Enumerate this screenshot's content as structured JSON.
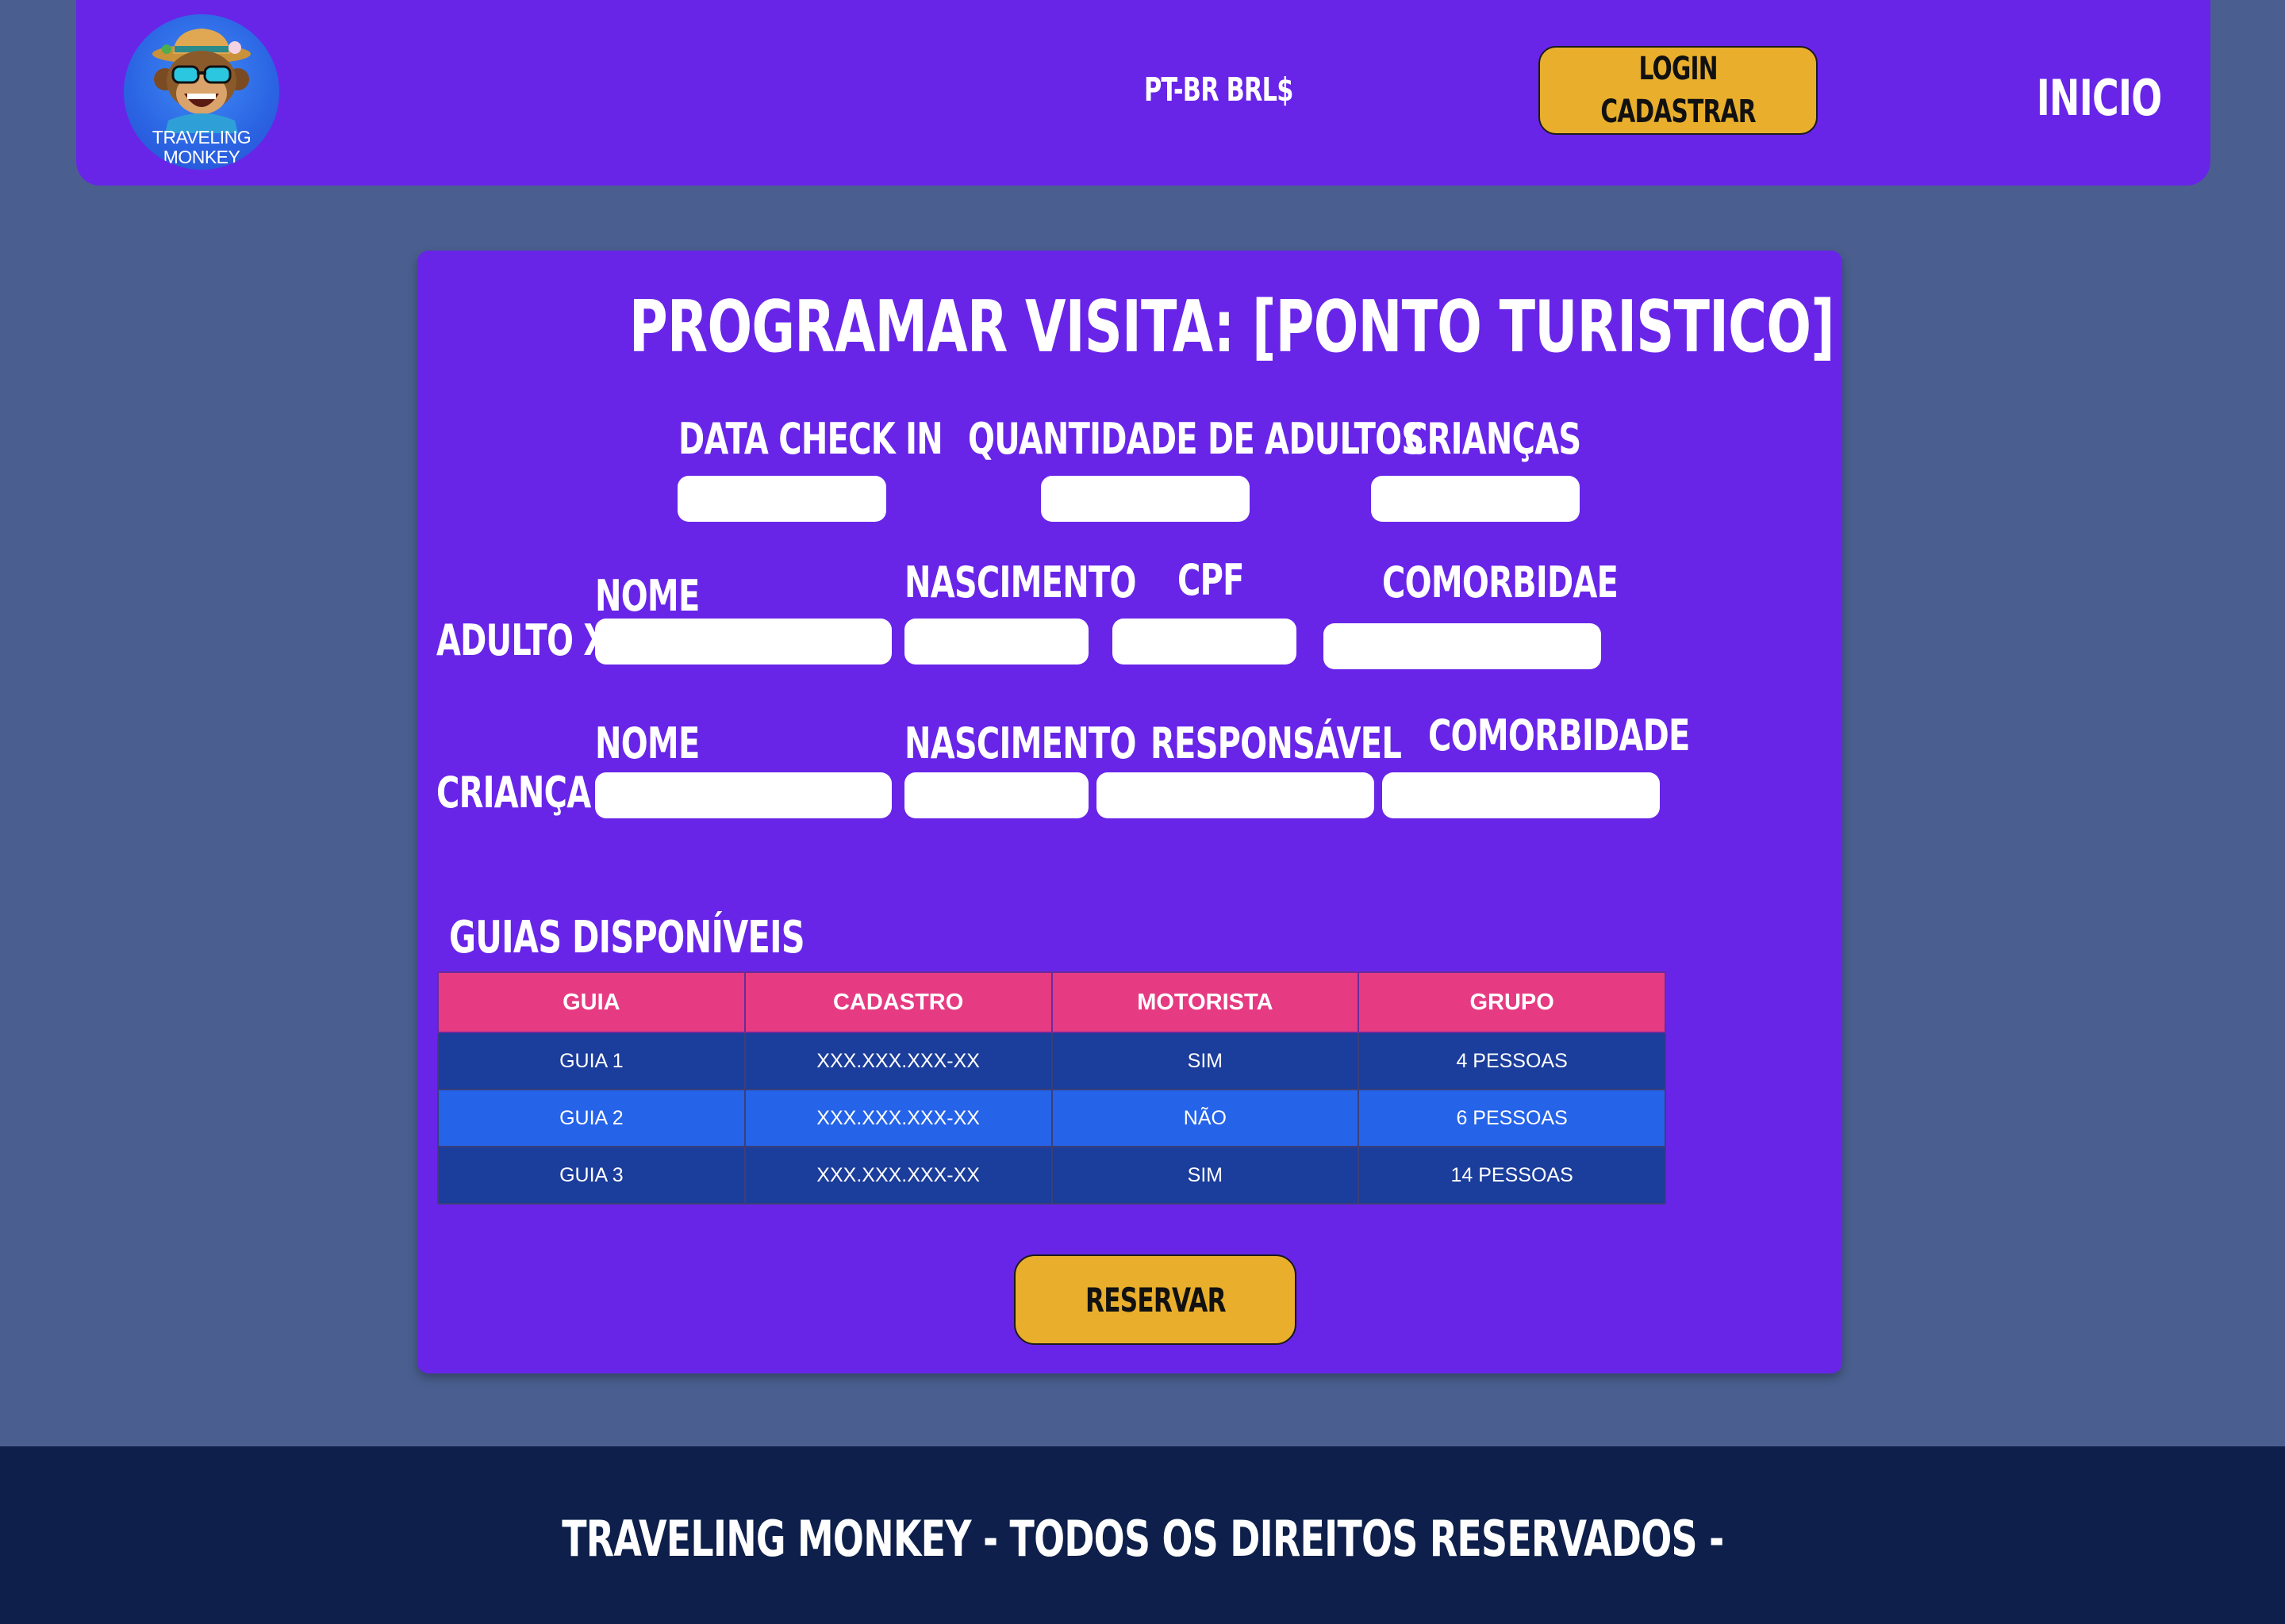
{
  "header": {
    "logo_line1": "TRAVELING",
    "logo_line2": "MONKEY",
    "locale": "PT-BR BRL$",
    "login_line1": "LOGIN",
    "login_line2": "CADASTRAR",
    "nav_home": "INICIO"
  },
  "form": {
    "title": "PROGRAMAR VISITA: [PONTO TURISTICO]",
    "checkin_label": "DATA CHECK IN",
    "adults_qty_label": "QUANTIDADE DE ADULTOS",
    "children_label": "CRIANÇAS",
    "adult": {
      "row_label": "ADULTO X",
      "name_label": "NOME",
      "birth_label": "NASCIMENTO",
      "cpf_label": "CPF",
      "comorbidity_label": "COMORBIDAE"
    },
    "child": {
      "row_label": "CRIANÇA X",
      "name_label": "NOME",
      "birth_label": "NASCIMENTO",
      "guardian_label": "RESPONSÁVEL",
      "comorbidity_label": "COMORBIDADE"
    }
  },
  "guides": {
    "title": "GUIAS DISPONÍVEIS",
    "columns": [
      "GUIA",
      "CADASTRO",
      "MOTORISTA",
      "GRUPO"
    ],
    "rows": [
      [
        "GUIA 1",
        "XXX.XXX.XXX-XX",
        "SIM",
        "4 PESSOAS"
      ],
      [
        "GUIA 2",
        "XXX.XXX.XXX-XX",
        "NÃO",
        "6 PESSOAS"
      ],
      [
        "GUIA 3",
        "XXX.XXX.XXX-XX",
        "SIM",
        "14 PESSOAS"
      ]
    ]
  },
  "reserve_button": "RESERVAR",
  "footer": {
    "text": "TRAVELING MONKEY - TODOS OS DIREITOS RESERVADOS -"
  },
  "colors": {
    "background": "#4a5f8f",
    "panel": "#6825e8",
    "button": "#e8ae2c",
    "table_header": "#e63a82",
    "row_dark": "#1b3d9b",
    "row_light": "#2563e8",
    "footer": "#0d1f4a"
  }
}
